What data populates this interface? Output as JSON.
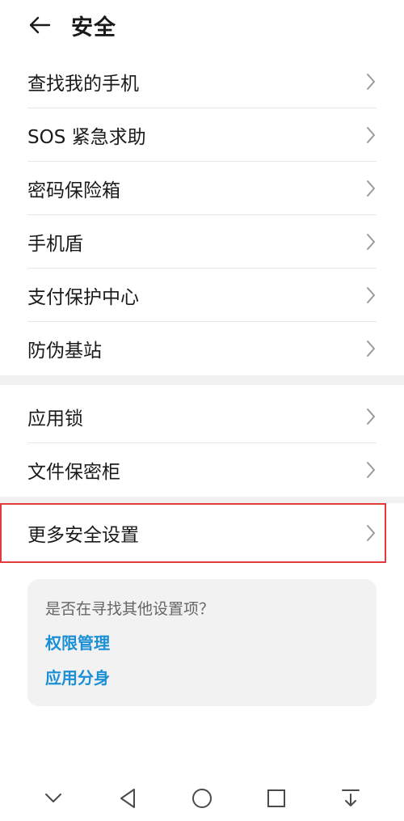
{
  "header": {
    "title": "安全",
    "back_icon": "back-arrow-icon"
  },
  "group1": {
    "items": [
      {
        "label": "查找我的手机"
      },
      {
        "label": "SOS 紧急求助"
      },
      {
        "label": "密码保险箱"
      },
      {
        "label": "手机盾"
      },
      {
        "label": "支付保护中心"
      },
      {
        "label": "防伪基站"
      }
    ]
  },
  "group2": {
    "items": [
      {
        "label": "应用锁"
      },
      {
        "label": "文件保密柜"
      }
    ]
  },
  "highlight": {
    "label": "更多安全设置",
    "border_color": "#e23b3b"
  },
  "suggest": {
    "title": "是否在寻找其他设置项？",
    "links": [
      "权限管理",
      "应用分身"
    ],
    "link_color": "#1a8fd6"
  },
  "navbar": {
    "icons": [
      "collapse-down-icon",
      "back-triangle-icon",
      "home-circle-icon",
      "recents-square-icon",
      "notification-pull-icon"
    ]
  }
}
